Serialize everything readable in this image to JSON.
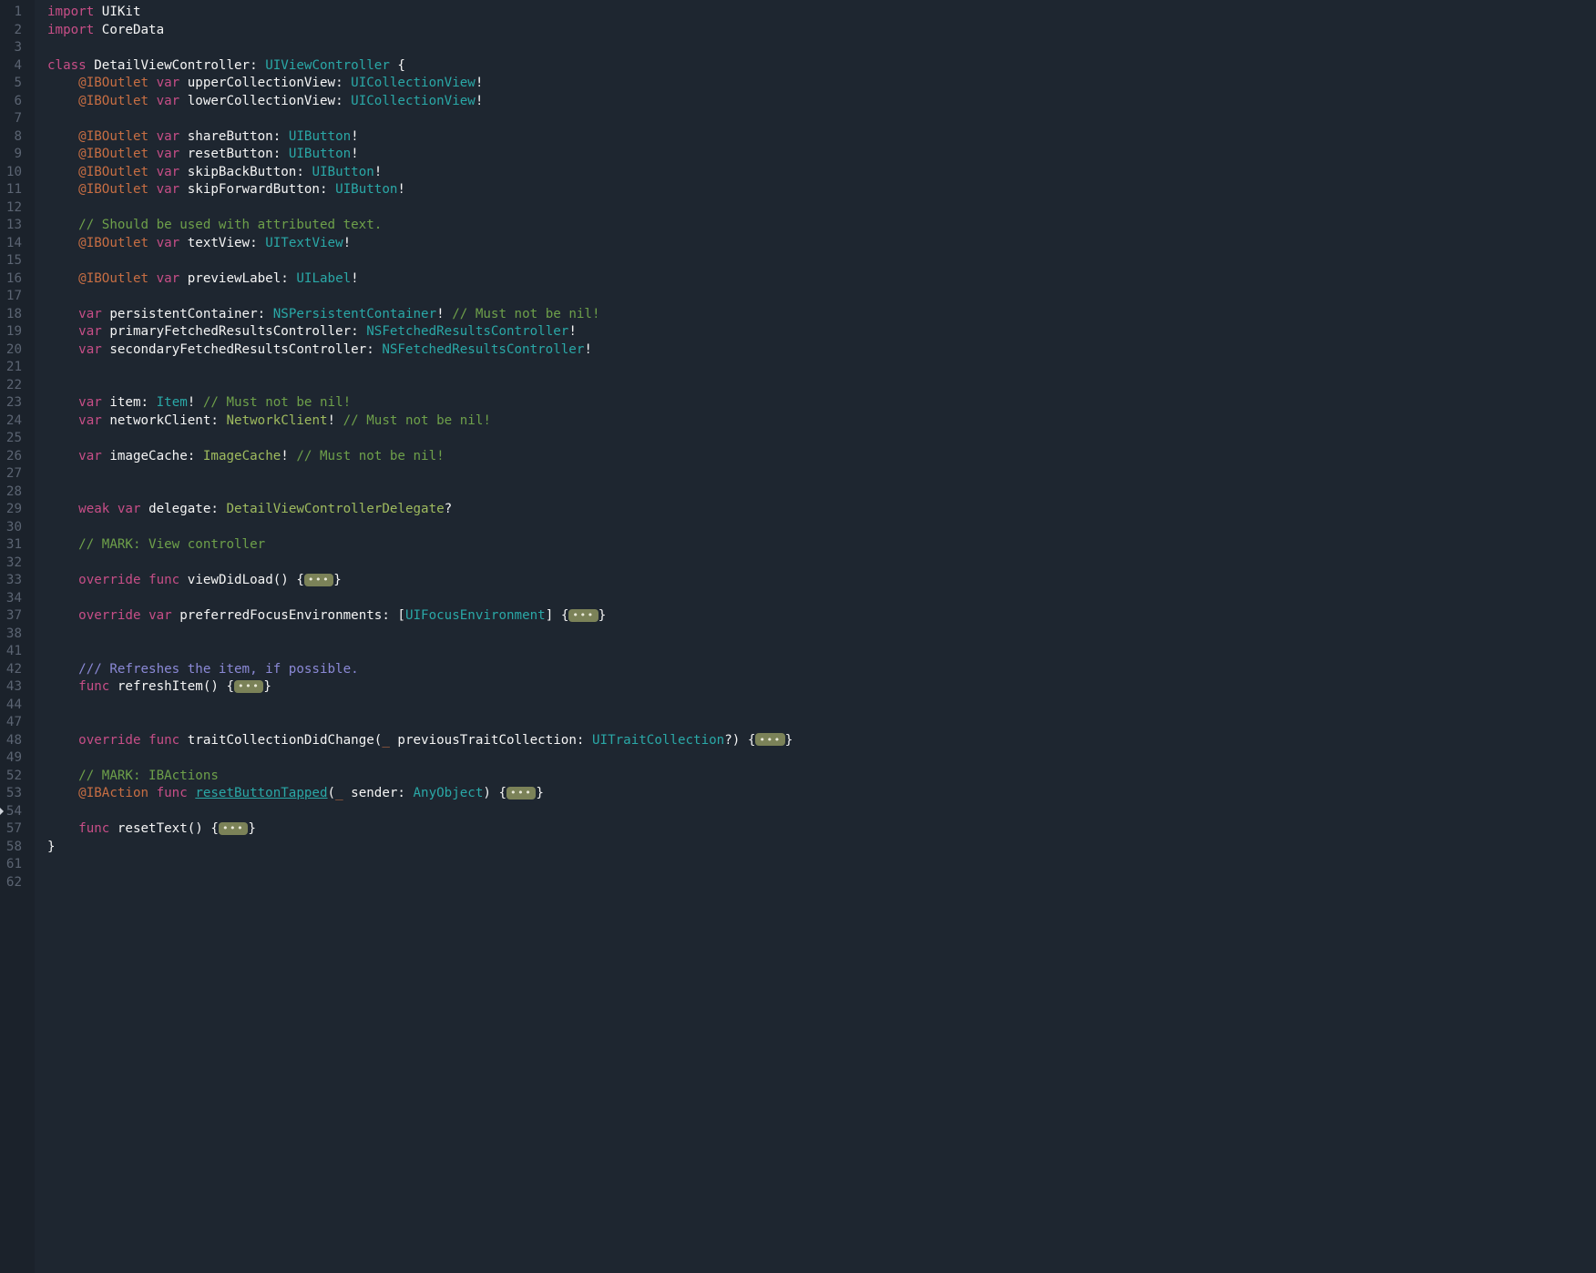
{
  "gutter_lines": [
    "1",
    "2",
    "3",
    "4",
    "5",
    "6",
    "7",
    "8",
    "9",
    "10",
    "11",
    "12",
    "13",
    "14",
    "15",
    "16",
    "17",
    "18",
    "19",
    "20",
    "21",
    "22",
    "23",
    "24",
    "25",
    "26",
    "27",
    "28",
    "29",
    "30",
    "31",
    "32",
    "33",
    "34",
    "37",
    "38",
    "41",
    "42",
    "43",
    "44",
    "47",
    "48",
    "49",
    "52",
    "53",
    "54",
    "57",
    "58",
    "61",
    "62"
  ],
  "cursor_gutter_line": "54",
  "fold_glyph": "•••",
  "code": {
    "l1": {
      "kw": "import",
      "sp": " ",
      "id": "UIKit"
    },
    "l2": {
      "kw": "import",
      "sp": " ",
      "id": "CoreData"
    },
    "l5": {
      "kw1": "class",
      "sp1": " ",
      "name": "DetailViewController",
      "colon": ": ",
      "type": "UIViewController",
      "sp2": " ",
      "open": "{"
    },
    "l6": {
      "ind": "    ",
      "attr": "@IBOutlet",
      "sp1": " ",
      "kw": "var",
      "sp2": " ",
      "id": "upperCollectionView",
      "colon": ": ",
      "type": "UICollectionView",
      "bang": "!"
    },
    "l7": {
      "ind": "    ",
      "attr": "@IBOutlet",
      "sp1": " ",
      "kw": "var",
      "sp2": " ",
      "id": "lowerCollectionView",
      "colon": ": ",
      "type": "UICollectionView",
      "bang": "!"
    },
    "l9": {
      "ind": "    ",
      "attr": "@IBOutlet",
      "sp1": " ",
      "kw": "var",
      "sp2": " ",
      "id": "shareButton",
      "colon": ": ",
      "type": "UIButton",
      "bang": "!"
    },
    "l10": {
      "ind": "    ",
      "attr": "@IBOutlet",
      "sp1": " ",
      "kw": "var",
      "sp2": " ",
      "id": "resetButton",
      "colon": ": ",
      "type": "UIButton",
      "bang": "!"
    },
    "l11": {
      "ind": "    ",
      "attr": "@IBOutlet",
      "sp1": " ",
      "kw": "var",
      "sp2": " ",
      "id": "skipBackButton",
      "colon": ": ",
      "type": "UIButton",
      "bang": "!"
    },
    "l12": {
      "ind": "    ",
      "attr": "@IBOutlet",
      "sp1": " ",
      "kw": "var",
      "sp2": " ",
      "id": "skipForwardButton",
      "colon": ": ",
      "type": "UIButton",
      "bang": "!"
    },
    "l14": {
      "ind": "    ",
      "cmt": "// Should be used with attributed text."
    },
    "l15": {
      "ind": "    ",
      "attr": "@IBOutlet",
      "sp1": " ",
      "kw": "var",
      "sp2": " ",
      "id": "textView",
      "colon": ": ",
      "type": "UITextView",
      "bang": "!"
    },
    "l17": {
      "ind": "    ",
      "attr": "@IBOutlet",
      "sp1": " ",
      "kw": "var",
      "sp2": " ",
      "id": "previewLabel",
      "colon": ": ",
      "type": "UILabel",
      "bang": "!"
    },
    "l19": {
      "ind": "    ",
      "kw": "var",
      "sp": " ",
      "id": "persistentContainer",
      "colon": ": ",
      "type": "NSPersistentContainer",
      "bang": "!",
      "sp2": " ",
      "cmt": "// Must not be nil!"
    },
    "l20": {
      "ind": "    ",
      "kw": "var",
      "sp": " ",
      "id": "primaryFetchedResultsController",
      "colon": ": ",
      "type": "NSFetchedResultsController",
      "bang": "!"
    },
    "l21": {
      "ind": "    ",
      "kw": "var",
      "sp": " ",
      "id": "secondaryFetchedResultsController",
      "colon": ": ",
      "type": "NSFetchedResultsController",
      "bang": "!"
    },
    "l24": {
      "ind": "    ",
      "kw": "var",
      "sp": " ",
      "id": "item",
      "colon": ": ",
      "type": "Item",
      "bang": "!",
      "sp2": " ",
      "cmt": "// Must not be nil!"
    },
    "l25": {
      "ind": "    ",
      "kw": "var",
      "sp": " ",
      "id": "networkClient",
      "colon": ": ",
      "utype": "NetworkClient",
      "bang": "!",
      "sp2": " ",
      "cmt": "// Must not be nil!"
    },
    "l27": {
      "ind": "    ",
      "kw": "var",
      "sp": " ",
      "id": "imageCache",
      "colon": ": ",
      "utype": "ImageCache",
      "bang": "!",
      "sp2": " ",
      "cmt": "// Must not be nil!"
    },
    "l30": {
      "ind": "    ",
      "kw1": "weak",
      "sp1": " ",
      "kw2": "var",
      "sp2": " ",
      "id": "delegate",
      "colon": ": ",
      "utype": "DetailViewControllerDelegate",
      "q": "?"
    },
    "l32": {
      "ind": "    ",
      "cmt": "// MARK: View controller"
    },
    "l34": {
      "ind": "    ",
      "kw1": "override",
      "sp1": " ",
      "kw2": "func",
      "sp2": " ",
      "fn": "viewDidLoad",
      "paren": "() ",
      "open": "{",
      "close": "}"
    },
    "l38": {
      "ind": "    ",
      "kw1": "override",
      "sp1": " ",
      "kw2": "var",
      "sp2": " ",
      "id": "preferredFocusEnvironments",
      "colon": ": ",
      "lb": "[",
      "type": "UIFocusEnvironment",
      "rb": "]",
      "sp3": " ",
      "open": "{",
      "close": "}"
    },
    "l43": {
      "ind": "    ",
      "doc": "/// Refreshes the item, if possible."
    },
    "l44": {
      "ind": "    ",
      "kw": "func",
      "sp": " ",
      "fn": "refreshItem",
      "paren": "() ",
      "open": "{",
      "close": "}"
    },
    "l49": {
      "ind": "    ",
      "kw1": "override",
      "sp1": " ",
      "kw2": "func",
      "sp2": " ",
      "fn": "traitCollectionDidChange",
      "lp": "(",
      "us": "_",
      "sp3": " ",
      "param": "previousTraitCollection",
      "colon": ": ",
      "type": "UITraitCollection",
      "q": "?",
      "rp": ")",
      "sp4": " ",
      "open": "{",
      "close": "}"
    },
    "l53": {
      "ind": "    ",
      "cmt": "// MARK: IBActions"
    },
    "l54": {
      "ind": "    ",
      "attr": "@IBAction",
      "sp1": " ",
      "kw": "func",
      "sp2": " ",
      "fn": "resetButtonTapped",
      "lp": "(",
      "us": "_",
      "sp3": " ",
      "param": "sender",
      "colon": ": ",
      "type": "AnyObject",
      "rp": ")",
      "sp4": " ",
      "open": "{",
      "close": "}"
    },
    "l58": {
      "ind": "    ",
      "kw": "func",
      "sp": " ",
      "fn": "resetText",
      "paren": "() ",
      "open": "{",
      "close": "}"
    },
    "l61": {
      "close": "}"
    }
  }
}
